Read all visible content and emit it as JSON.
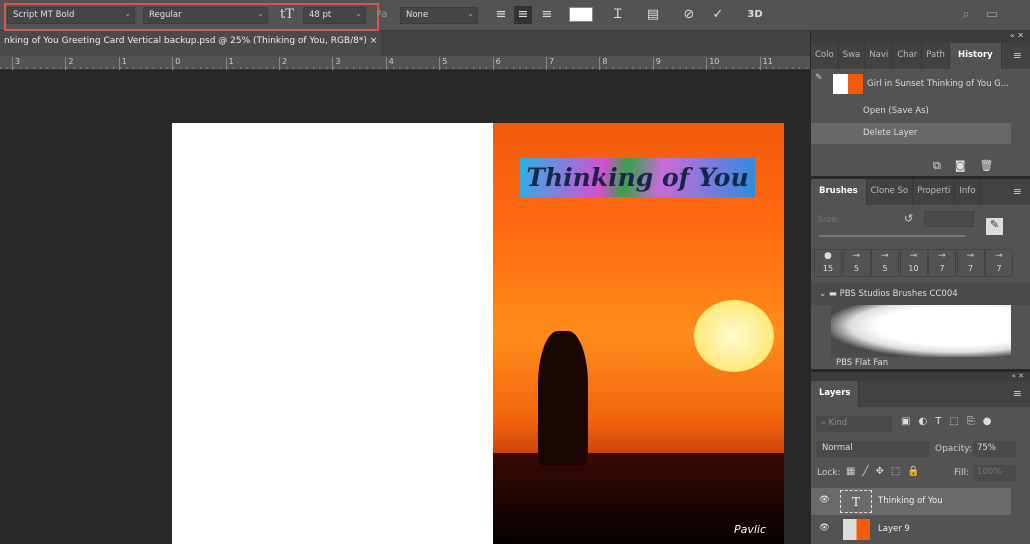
{
  "options_bar": {
    "font_family": "Script MT Bold",
    "font_style": "Regular",
    "font_size": "48 pt",
    "anti_alias": "None",
    "text_color": "#ffffff",
    "align": [
      "left",
      "center",
      "right"
    ],
    "align_selected": "center",
    "three_d": "3D"
  },
  "document_tab": {
    "title": "nking of You Greeting Card Vertical backup.psd @ 25% (Thinking of You, RGB/8*)",
    "close": "×"
  },
  "ruler": {
    "labels": [
      "3",
      "2",
      "1",
      "0",
      "1",
      "2",
      "3",
      "4",
      "5",
      "6",
      "7",
      "8",
      "9",
      "10",
      "11"
    ]
  },
  "canvas": {
    "banner_text": "Thinking of You",
    "signature": "Pavlic",
    "colors": {
      "sky": "#ff6a10",
      "sun": "#ffe97a"
    }
  },
  "history_panel": {
    "tabs": [
      "Colo",
      "Swa",
      "Navi",
      "Char",
      "Path",
      "History"
    ],
    "active": "History",
    "snapshot": "Girl in Sunset Thinking of You G...",
    "items": [
      "Open (Save As)",
      "Delete Layer"
    ]
  },
  "brushes_panel": {
    "tabs": [
      "Brushes",
      "Clone So",
      "Properti",
      "Info"
    ],
    "active": "Brushes",
    "size_label": "Size:",
    "presets": [
      "15",
      "5",
      "5",
      "10",
      "7",
      "7",
      "7"
    ],
    "group": "PBS Studios Brushes CC004",
    "brush_name": "PBS Flat Fan"
  },
  "layers_panel": {
    "title": "Layers",
    "kind_placeholder": "Kind",
    "blend_mode": "Normal",
    "opacity_label": "Opacity:",
    "opacity": "75%",
    "lock_label": "Lock:",
    "fill_label": "Fill:",
    "fill": "100%",
    "layers": [
      {
        "name": "Thinking of You",
        "type": "text",
        "visible": true,
        "selected": true
      },
      {
        "name": "Layer 9",
        "type": "image",
        "visible": true,
        "selected": false
      }
    ]
  }
}
